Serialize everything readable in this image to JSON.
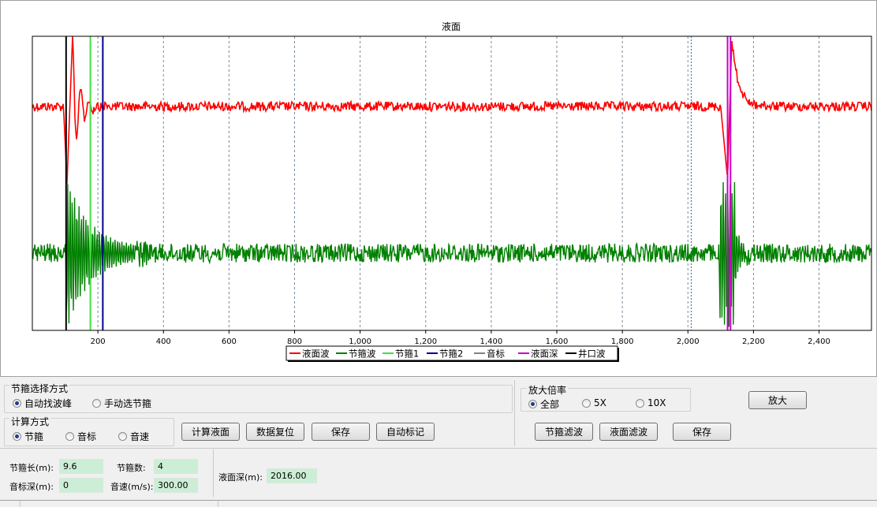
{
  "chart_data": {
    "type": "line",
    "title": "液面",
    "xlim": [
      0,
      2560
    ],
    "x_ticks": [
      200,
      400,
      600,
      800,
      1000,
      1200,
      1400,
      1600,
      1800,
      2000,
      2200,
      2400
    ],
    "x_tick_labels": [
      "200",
      "400",
      "600",
      "800",
      "1,000",
      "1,200",
      "1,400",
      "1,600",
      "1,800",
      "2,000",
      "2,200",
      "2,400"
    ],
    "grid": "vertical dashed",
    "legend_position": "bottom-center",
    "series": [
      {
        "name": "液面波",
        "color": "#ff0000"
      },
      {
        "name": "节箍波",
        "color": "#008000"
      },
      {
        "name": "节箍1",
        "color": "#40e040"
      },
      {
        "name": "节箍2",
        "color": "#00008b"
      },
      {
        "name": "音标",
        "color": "#808080"
      },
      {
        "name": "液面深",
        "color": "#cc00cc"
      },
      {
        "name": "井口波",
        "color": "#000000"
      }
    ],
    "markers": [
      {
        "series": "井口波",
        "x": 103,
        "color": "#000000"
      },
      {
        "series": "节箍1",
        "x": 177,
        "color": "#40e040"
      },
      {
        "series": "节箍2",
        "x": 215,
        "color": "#00008b"
      },
      {
        "series": "液面深",
        "x": 2121,
        "color": "#cc00cc"
      },
      {
        "series": "液面深",
        "x": 2130,
        "color": "#cc00cc"
      }
    ]
  },
  "controls": {
    "collar_select": {
      "title": "节箍选择方式",
      "options": [
        {
          "label": "自动找波峰",
          "selected": true
        },
        {
          "label": "手动选节箍",
          "selected": false
        }
      ]
    },
    "calc_method": {
      "title": "计算方式",
      "options": [
        {
          "label": "节箍",
          "selected": true
        },
        {
          "label": "音标",
          "selected": false
        },
        {
          "label": "音速",
          "selected": false
        }
      ]
    },
    "zoom": {
      "title": "放大倍率",
      "options": [
        {
          "label": "全部",
          "selected": true
        },
        {
          "label": "5X",
          "selected": false
        },
        {
          "label": "10X",
          "selected": false
        }
      ],
      "zoom_button": "放大"
    },
    "buttons": {
      "calc_level": "计算液面",
      "data_reset": "数据复位",
      "save": "保存",
      "auto_mark": "自动标记",
      "collar_filter": "节箍滤波",
      "level_filter": "液面滤波",
      "save2": "保存"
    },
    "fields": {
      "collar_len_label": "节箍长(m):",
      "collar_len_value": "9.6",
      "collar_count_label": "节箍数:",
      "collar_count_value": "4",
      "marker_depth_label": "音标深(m):",
      "marker_depth_value": "0",
      "sound_speed_label": "音速(m/s):",
      "sound_speed_value": "300.00",
      "level_depth_label": "液面深(m):",
      "level_depth_value": "2016.00"
    }
  }
}
